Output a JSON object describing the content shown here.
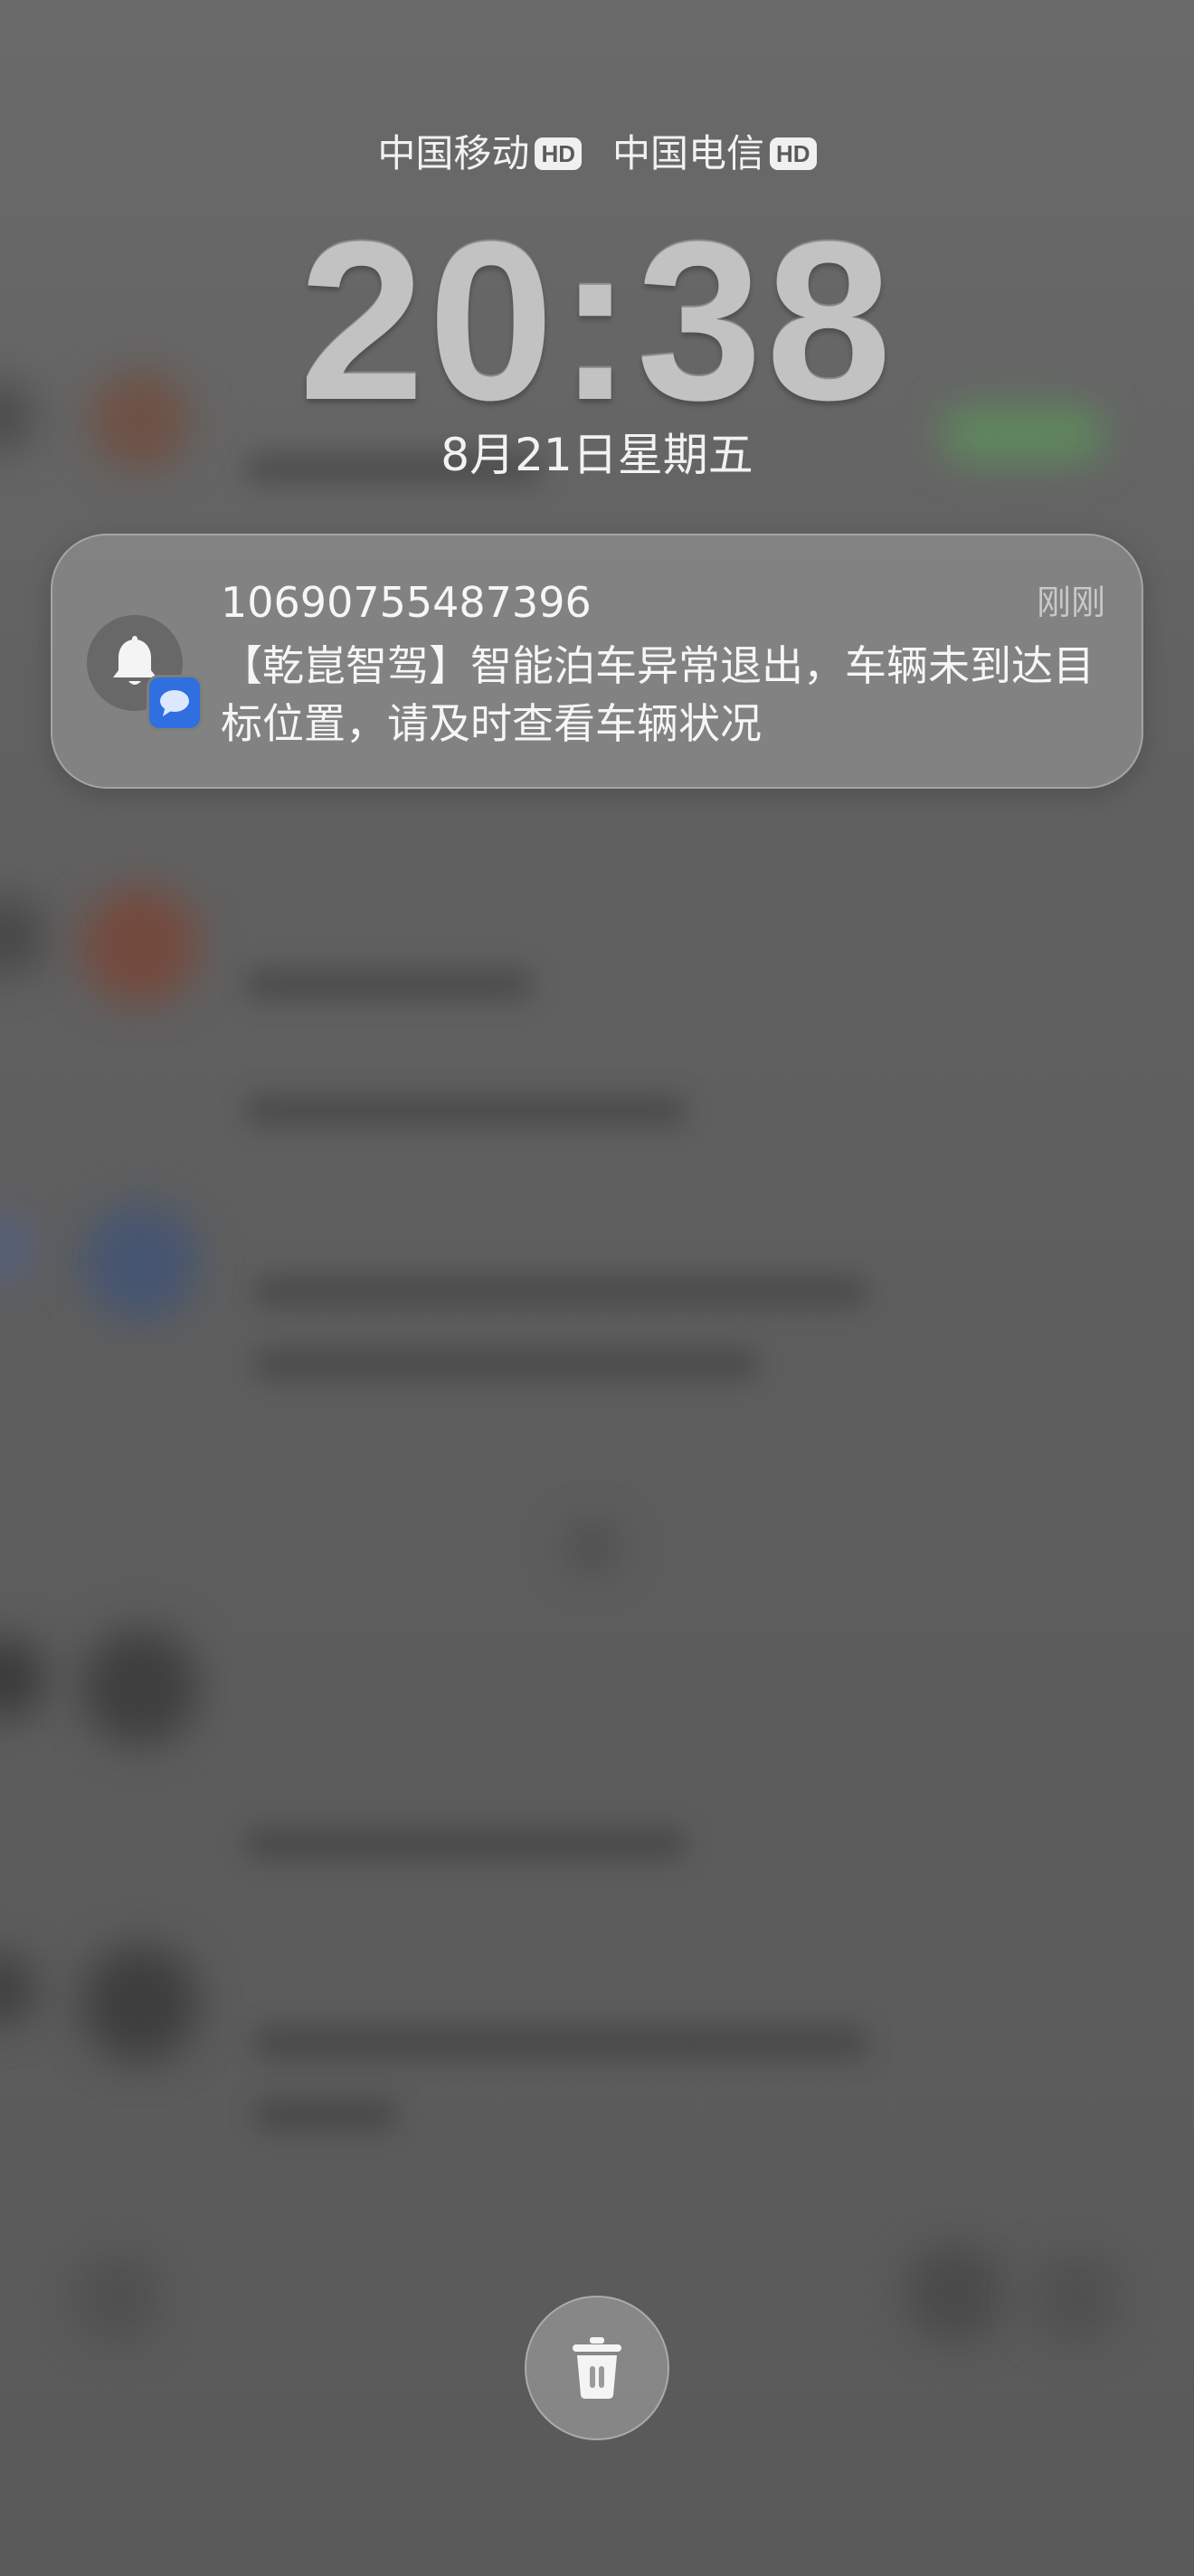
{
  "status": {
    "carriers": [
      {
        "name": "中国移动",
        "badge": "HD"
      },
      {
        "name": "中国电信",
        "badge": "HD"
      }
    ]
  },
  "lockscreen": {
    "time": "20:38",
    "date": "8月21日星期五"
  },
  "notification": {
    "sender": "10690755487396",
    "time": "刚刚",
    "message": "【乾崑智驾】智能泊车异常退出，车辆未到达目标位置，请及时查看车辆状况",
    "app_icon": "bell-icon",
    "badge_icon": "message-bubble-icon",
    "badge_color": "#2f6fdf"
  },
  "actions": {
    "clear_icon": "trash-icon"
  }
}
